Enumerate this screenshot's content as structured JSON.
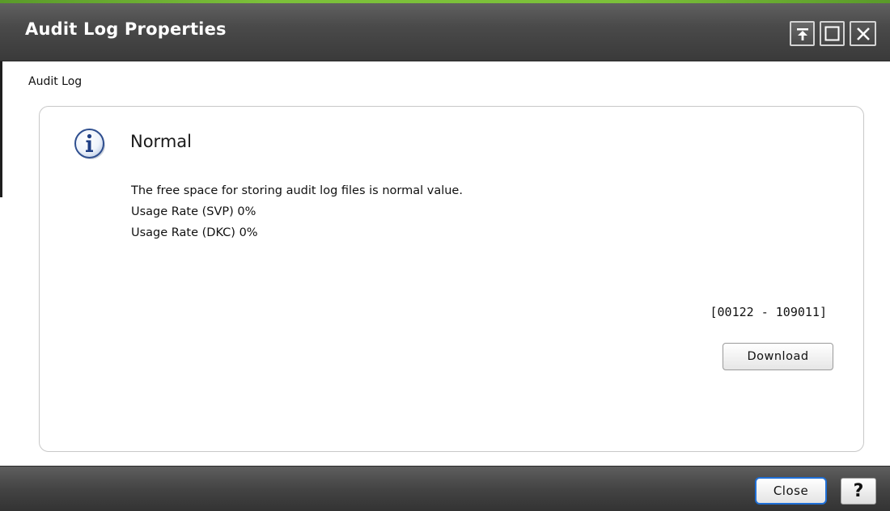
{
  "window": {
    "title": "Audit Log Properties",
    "pin_icon": "pin-top-icon",
    "maximize_icon": "maximize-icon",
    "close_icon": "close-icon"
  },
  "section": {
    "label": "Audit Log"
  },
  "status": {
    "icon": "info-icon",
    "title": "Normal",
    "messages": [
      "The free space for storing audit log files is normal value.",
      "Usage Rate (SVP) 0%",
      "Usage Rate (DKC) 0%"
    ],
    "range": "[00122 - 109011]"
  },
  "actions": {
    "download_label": "Download"
  },
  "footer": {
    "close_label": "Close",
    "help_label": "?"
  },
  "colors": {
    "accent": "#7cc03a",
    "titlebar": "#4a4a4a",
    "focus": "#1f6fd6"
  }
}
